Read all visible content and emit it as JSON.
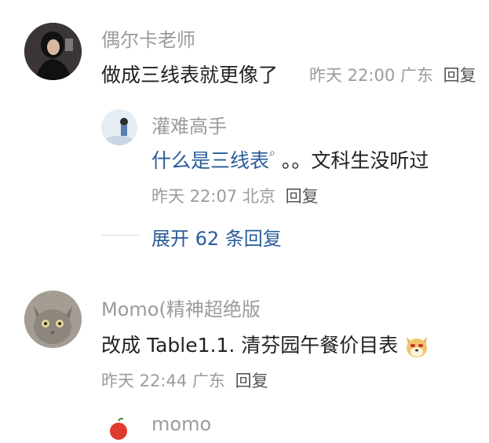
{
  "comments": [
    {
      "author": "偶尔卡老师",
      "text": "做成三线表就更像了",
      "time": "昨天 22:00",
      "region": "广东",
      "reply_label": "回复",
      "avatar_icon": "user-photo"
    },
    {
      "author": "Momo(精神超绝版",
      "text_prefix": "改成 Table1.1. 清芬园午餐价目表",
      "emoji_icon": "dog-face-emoji",
      "time": "昨天 22:44",
      "region": "广东",
      "reply_label": "回复",
      "avatar_icon": "cat-photo"
    }
  ],
  "reply": {
    "author": "灌难高手",
    "link_text": "什么是三线表",
    "link_icon": "search-icon",
    "rest_text": "。。文科生没听过",
    "time": "昨天 22:07",
    "region": "北京",
    "reply_label": "回复"
  },
  "expand": {
    "label": "展开 62 条回复"
  },
  "partial": {
    "author": "momo",
    "avatar_icon": "apple-emoji"
  }
}
